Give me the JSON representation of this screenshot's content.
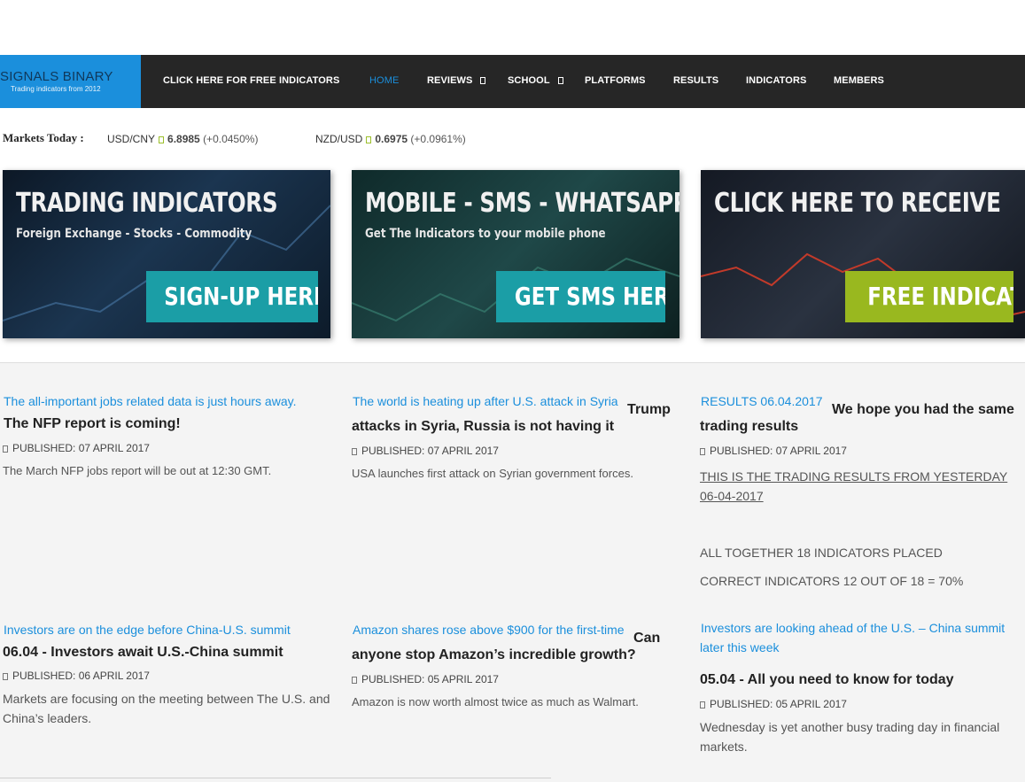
{
  "logo": {
    "title": "SIGNALS BINARY",
    "subtitle": "Trading indicators from 2012"
  },
  "nav": {
    "items": [
      {
        "label": "CLICK HERE FOR FREE INDICATORS"
      },
      {
        "label": "HOME"
      },
      {
        "label": "REVIEWS"
      },
      {
        "label": "SCHOOL"
      },
      {
        "label": "PLATFORMS"
      },
      {
        "label": "RESULTS"
      },
      {
        "label": "INDICATORS"
      },
      {
        "label": "MEMBERS"
      }
    ]
  },
  "ticker": {
    "label": "Markets Today :",
    "quotes": [
      {
        "symbol": "USD/CNY",
        "price": "6.8985",
        "change": "(+0.0450%)"
      },
      {
        "symbol": "NZD/USD",
        "price": "0.6975",
        "change": "(+0.0961%)"
      }
    ]
  },
  "banners": [
    {
      "heading": "TRADING INDICATORS",
      "sub": "Foreign Exchange  -  Stocks  -  Commodity",
      "button": "SIGN-UP HERE"
    },
    {
      "heading": "MOBILE - SMS - WHATSAPP",
      "sub": "Get The Indicators to your mobile phone",
      "button": "GET SMS HERE"
    },
    {
      "heading": "CLICK HERE TO RECEIVE",
      "sub": "",
      "button": "FREE INDICATORS"
    }
  ],
  "articles": [
    {
      "img_alt": "The all-important jobs related data is just hours away.",
      "title": "The NFP report is coming!",
      "published": "PUBLISHED: 07 APRIL 2017",
      "excerpt": "The March NFP jobs report will be out at 12:30 GMT."
    },
    {
      "img_alt": "The world is heating up after U.S. attack in Syria",
      "title_start": "Trump",
      "title_rest": "attacks in Syria, Russia is not having it",
      "published": "PUBLISHED: 07 APRIL 2017",
      "excerpt": "USA launches first attack on Syrian government forces."
    },
    {
      "img_alt": "RESULTS 06.04.2017",
      "title_start": "We hope you had the same",
      "title_rest": "trading results",
      "published": "PUBLISHED: 07 APRIL 2017",
      "link": "THIS IS THE TRADING RESULTS FROM YESTERDAY 06-04-2017",
      "line1": "ALL TOGETHER 18 INDICATORS PLACED",
      "line2": "CORRECT INDICATORS 12 OUT OF 18 = 70%"
    },
    {
      "img_alt": "Investors are on the edge before China-U.S. summit",
      "title": "06.04 - Investors await U.S.-China summit",
      "published": "PUBLISHED: 06 APRIL 2017",
      "excerpt": "Markets are focusing on the meeting between The U.S. and China’s leaders."
    },
    {
      "img_alt": "Amazon shares rose above $900 for the first-time",
      "title_start": "Can",
      "title_rest": "anyone stop Amazon’s incredible growth?",
      "published": "PUBLISHED: 05 APRIL 2017",
      "excerpt": "Amazon is now worth almost twice as much as Walmart."
    },
    {
      "img_alt": "Investors are looking ahead of the U.S. – China summit later this week",
      "title": "05.04 - All you need to know for today",
      "published": "PUBLISHED: 05 APRIL 2017",
      "excerpt": "Wednesday is yet another busy trading day in financial markets."
    }
  ]
}
